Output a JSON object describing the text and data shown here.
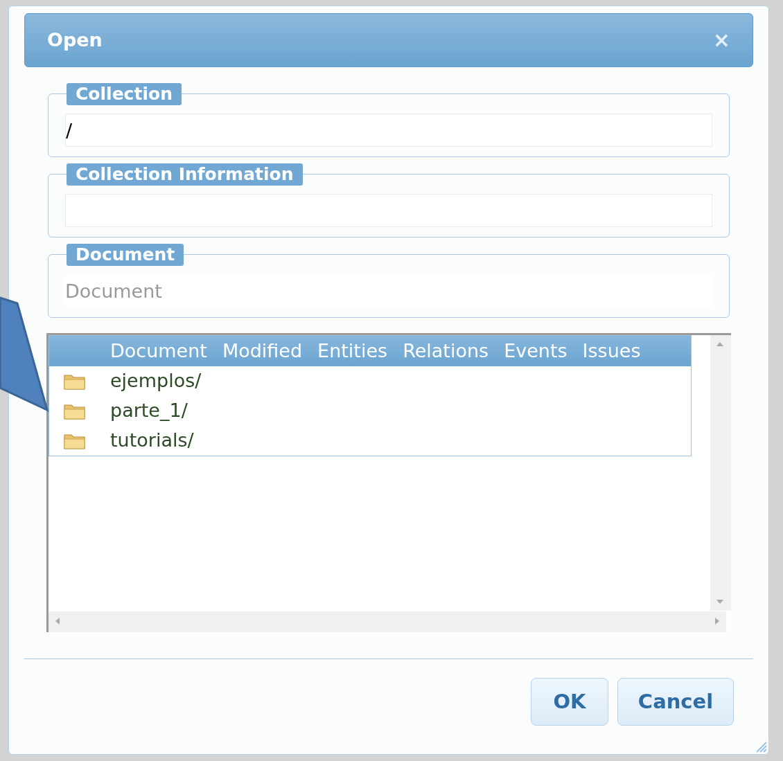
{
  "window": {
    "title": "Open",
    "close": "×"
  },
  "fields": [
    {
      "legend": "Collection",
      "value": "/"
    },
    {
      "legend": "Collection Information"
    },
    {
      "legend": "Document",
      "placeholder": "Document"
    }
  ],
  "table": {
    "columns": [
      "Document",
      "Modified",
      "Entities",
      "Relations",
      "Events",
      "Issues"
    ],
    "rows": [
      {
        "name": "ejemplos/",
        "kind": "folder"
      },
      {
        "name": "parte_1/",
        "kind": "folder"
      },
      {
        "name": "tutorials/",
        "kind": "folder"
      }
    ]
  },
  "buttons": [
    "OK",
    "Cancel"
  ]
}
